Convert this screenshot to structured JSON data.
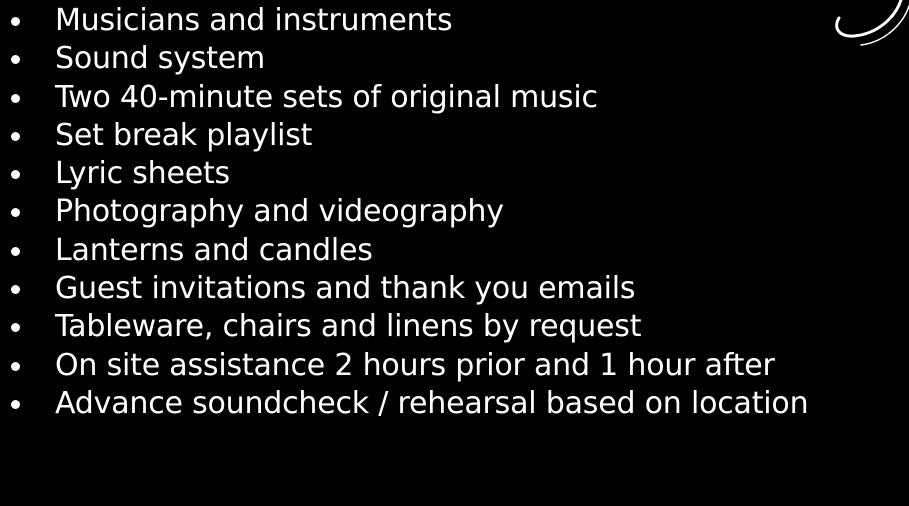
{
  "items": [
    "Musicians and instruments",
    "Sound system",
    "Two 40-minute sets of original music",
    "Set break playlist",
    "Lyric sheets",
    "Photography and videography",
    "Lanterns and candles",
    "Guest invitations and thank you emails",
    "Tableware, chairs and linens by request",
    "On site assistance 2 hours prior and 1 hour after",
    "Advance soundcheck / rehearsal based on location"
  ],
  "colors": {
    "background": "#000000",
    "text": "#ffffff"
  },
  "icons": {
    "bullet": "bullet-dot-icon",
    "ornament": "swirl-ornament-icon"
  }
}
